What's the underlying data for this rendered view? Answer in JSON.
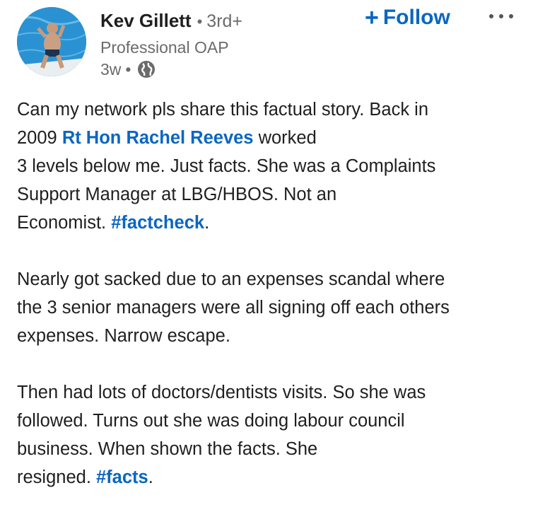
{
  "author": {
    "name": "Kev Gillett",
    "separator": "•",
    "degree": "3rd+",
    "headline": "Professional OAP",
    "time": "3w",
    "meta_separator": "•",
    "visibility_icon": "globe-icon",
    "avatar_icon": "profile-photo"
  },
  "actions": {
    "follow_icon": "+",
    "follow_label": "Follow",
    "more_icon": "ellipsis-icon"
  },
  "colors": {
    "link_blue": "#0a66c2",
    "text": "#1f1f1f",
    "muted": "#6b6b6b"
  },
  "post": {
    "p1": {
      "l1": "Can my network pls share this factual story. Back in",
      "l2a": "2009 ",
      "mention": "Rt Hon Rachel Reeves",
      "l2b": " worked",
      "l3": "3 levels below me. Just facts. She was a Complaints",
      "l4": "Support Manager at LBG/HBOS. Not an",
      "l5a": "Economist. ",
      "hashtag": "#factcheck",
      "l5b": "."
    },
    "p2": {
      "l1": "Nearly got sacked due to an expenses scandal where",
      "l2": "the 3 senior managers were all signing off each others",
      "l3": "expenses. Narrow escape."
    },
    "p3": {
      "l1": "Then had lots of doctors/dentists visits. So she was",
      "l2": "followed. Turns out she was doing labour council",
      "l3": "business. When shown the facts. She",
      "l4a": "resigned. ",
      "hashtag": "#facts",
      "l4b": "."
    }
  }
}
